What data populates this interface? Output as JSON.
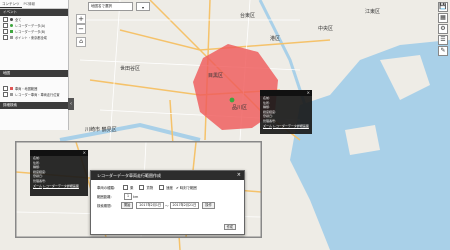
{
  "left_panel": {
    "tabs": [
      "コンテンツ",
      "PC情報"
    ],
    "section1": "イベント",
    "items": [
      {
        "label": "全て",
        "color": "#4a4a4a"
      },
      {
        "label": "レコーダーデータ(A)",
        "color": "#3ea63e"
      },
      {
        "label": "レコーダーデータ(B)",
        "color": "#3ea63e"
      },
      {
        "label": "ポイント・東京都全域",
        "color": "#999999"
      }
    ],
    "section2": "地図",
    "items2": [
      {
        "label": "車両・地図範囲",
        "color": "#e05757"
      },
      {
        "label": "レコーダー車両・車両走行位置",
        "color": "#999999"
      }
    ],
    "section3": "詳細検索"
  },
  "search": {
    "placeholder": "地図名で選択",
    "button": "▾"
  },
  "map": {
    "labels": [
      {
        "text": "江東区"
      },
      {
        "text": "中央区"
      },
      {
        "text": "港区"
      },
      {
        "text": "渋谷区"
      },
      {
        "text": "世田谷区"
      },
      {
        "text": "目黒区"
      },
      {
        "text": "品川区"
      },
      {
        "text": "川崎市"
      },
      {
        "text": "川崎市 鶴見区"
      },
      {
        "text": "大田区"
      },
      {
        "text": "台東区"
      }
    ],
    "area_color": "#ef5a5a"
  },
  "popup1": {
    "close": "×",
    "lines": [
      "名前:",
      "住所:",
      "種類:",
      "緯度経度:",
      "登録日:",
      "管理番号:",
      "車両番号:"
    ],
    "link1": "ズーム",
    "link2": "レコーダーデータ詳細画面"
  },
  "popup2": {
    "close": "×",
    "lines": [
      "名前:",
      "住所:",
      "種類:",
      "緯度経度:",
      "登録日:",
      "管理番号:",
      "車両番号:"
    ],
    "link1": "ズーム",
    "link2": "レコーダーデータ詳細画面"
  },
  "dialog": {
    "title": "レコーダーデータ車両走行範囲作成",
    "close": "×",
    "row1_label": "車両の種類:",
    "row1_opts": [
      "乗",
      "貨物",
      "速度"
    ],
    "row1_check": "時刻で範囲",
    "row2_label": "範囲距離:",
    "row2_value": "1",
    "row2_unit": "km",
    "row3_label": "検索期間:",
    "row3_btn1": "開始",
    "row3_from": "2017年2月1日",
    "row3_sep": "〜",
    "row3_to": "2017年2月21日",
    "row3_btn2": "操作",
    "ok": "作成"
  },
  "right_tools": [
    "💾",
    "▦",
    "⚙",
    "☰",
    "✎"
  ]
}
